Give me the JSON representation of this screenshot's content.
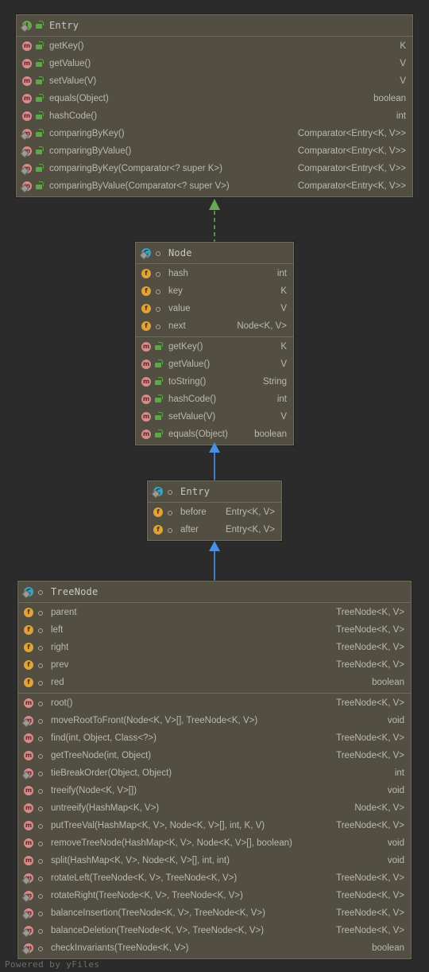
{
  "diagram": {
    "watermark": "Powered by yFiles",
    "colors": {
      "background": "#2b2b2b",
      "box_fill": "#524e42",
      "box_border": "#6e6a5c",
      "text": "#b9b9b4",
      "title_text": "#c8c8c4",
      "interface_icon": "#6aa84f",
      "class_icon": "#3ba3c4",
      "field_icon": "#e0a33b",
      "method_icon": "#d98a8a",
      "realization_edge": "#6aa84f",
      "generalization_edge": "#4a90e2"
    }
  },
  "boxes": [
    {
      "id": "entry-interface",
      "name": "Entry",
      "stereotype_icon": "interface-icon",
      "visibility": "public",
      "sections": [
        {
          "members": [
            {
              "icon": "method-icon",
              "static": false,
              "visibility": "public",
              "name": "getKey()",
              "type": "K"
            },
            {
              "icon": "method-icon",
              "static": false,
              "visibility": "public",
              "name": "getValue()",
              "type": "V"
            },
            {
              "icon": "method-icon",
              "static": false,
              "visibility": "public",
              "name": "setValue(V)",
              "type": "V"
            },
            {
              "icon": "method-icon",
              "static": false,
              "visibility": "public",
              "name": "equals(Object)",
              "type": "boolean"
            },
            {
              "icon": "method-icon",
              "static": false,
              "visibility": "public",
              "name": "hashCode()",
              "type": "int"
            },
            {
              "icon": "method-icon",
              "static": true,
              "visibility": "public",
              "name": "comparingByKey()",
              "type": "Comparator<Entry<K, V>>"
            },
            {
              "icon": "method-icon",
              "static": true,
              "visibility": "public",
              "name": "comparingByValue()",
              "type": "Comparator<Entry<K, V>>"
            },
            {
              "icon": "method-icon",
              "static": true,
              "visibility": "public",
              "name": "comparingByKey(Comparator<? super K>)",
              "type": "Comparator<Entry<K, V>>"
            },
            {
              "icon": "method-icon",
              "static": true,
              "visibility": "public",
              "name": "comparingByValue(Comparator<? super V>)",
              "type": "Comparator<Entry<K, V>>"
            }
          ]
        }
      ]
    },
    {
      "id": "node-class",
      "name": "Node",
      "stereotype_icon": "class-icon",
      "visibility": "package",
      "sections": [
        {
          "members": [
            {
              "icon": "field-icon",
              "static": false,
              "visibility": "package",
              "name": "hash",
              "type": "int"
            },
            {
              "icon": "field-icon",
              "static": false,
              "visibility": "package",
              "name": "key",
              "type": "K"
            },
            {
              "icon": "field-icon",
              "static": false,
              "visibility": "package",
              "name": "value",
              "type": "V"
            },
            {
              "icon": "field-icon",
              "static": false,
              "visibility": "package",
              "name": "next",
              "type": "Node<K, V>"
            }
          ]
        },
        {
          "members": [
            {
              "icon": "method-icon",
              "static": false,
              "visibility": "public",
              "name": "getKey()",
              "type": "K"
            },
            {
              "icon": "method-icon",
              "static": false,
              "visibility": "public",
              "name": "getValue()",
              "type": "V"
            },
            {
              "icon": "method-icon",
              "static": false,
              "visibility": "public",
              "name": "toString()",
              "type": "String"
            },
            {
              "icon": "method-icon",
              "static": false,
              "visibility": "public",
              "name": "hashCode()",
              "type": "int"
            },
            {
              "icon": "method-icon",
              "static": false,
              "visibility": "public",
              "name": "setValue(V)",
              "type": "V"
            },
            {
              "icon": "method-icon",
              "static": false,
              "visibility": "public",
              "name": "equals(Object)",
              "type": "boolean"
            }
          ]
        }
      ]
    },
    {
      "id": "entry-class",
      "name": "Entry",
      "stereotype_icon": "class-icon",
      "visibility": "package",
      "sections": [
        {
          "members": [
            {
              "icon": "field-icon",
              "static": false,
              "visibility": "package",
              "name": "before",
              "type": "Entry<K, V>"
            },
            {
              "icon": "field-icon",
              "static": false,
              "visibility": "package",
              "name": "after",
              "type": "Entry<K, V>"
            }
          ]
        }
      ]
    },
    {
      "id": "treenode-class",
      "name": "TreeNode",
      "stereotype_icon": "class-icon",
      "visibility": "package",
      "sections": [
        {
          "members": [
            {
              "icon": "field-icon",
              "static": false,
              "visibility": "package",
              "name": "parent",
              "type": "TreeNode<K, V>"
            },
            {
              "icon": "field-icon",
              "static": false,
              "visibility": "package",
              "name": "left",
              "type": "TreeNode<K, V>"
            },
            {
              "icon": "field-icon",
              "static": false,
              "visibility": "package",
              "name": "right",
              "type": "TreeNode<K, V>"
            },
            {
              "icon": "field-icon",
              "static": false,
              "visibility": "package",
              "name": "prev",
              "type": "TreeNode<K, V>"
            },
            {
              "icon": "field-icon",
              "static": false,
              "visibility": "package",
              "name": "red",
              "type": "boolean"
            }
          ]
        },
        {
          "members": [
            {
              "icon": "method-icon",
              "static": false,
              "visibility": "package",
              "name": "root()",
              "type": "TreeNode<K, V>"
            },
            {
              "icon": "method-icon",
              "static": true,
              "visibility": "package",
              "name": "moveRootToFront(Node<K, V>[], TreeNode<K, V>)",
              "type": "void"
            },
            {
              "icon": "method-icon",
              "static": false,
              "visibility": "package",
              "name": "find(int, Object, Class<?>)",
              "type": "TreeNode<K, V>"
            },
            {
              "icon": "method-icon",
              "static": false,
              "visibility": "package",
              "name": "getTreeNode(int, Object)",
              "type": "TreeNode<K, V>"
            },
            {
              "icon": "method-icon",
              "static": true,
              "visibility": "package",
              "name": "tieBreakOrder(Object, Object)",
              "type": "int"
            },
            {
              "icon": "method-icon",
              "static": false,
              "visibility": "package",
              "name": "treeify(Node<K, V>[])",
              "type": "void"
            },
            {
              "icon": "method-icon",
              "static": false,
              "visibility": "package",
              "name": "untreeify(HashMap<K, V>)",
              "type": "Node<K, V>"
            },
            {
              "icon": "method-icon",
              "static": false,
              "visibility": "package",
              "name": "putTreeVal(HashMap<K, V>, Node<K, V>[], int, K, V)",
              "type": "TreeNode<K, V>"
            },
            {
              "icon": "method-icon",
              "static": false,
              "visibility": "package",
              "name": "removeTreeNode(HashMap<K, V>, Node<K, V>[], boolean)",
              "type": "void"
            },
            {
              "icon": "method-icon",
              "static": false,
              "visibility": "package",
              "name": "split(HashMap<K, V>, Node<K, V>[], int, int)",
              "type": "void"
            },
            {
              "icon": "method-icon",
              "static": true,
              "visibility": "package",
              "name": "rotateLeft(TreeNode<K, V>, TreeNode<K, V>)",
              "type": "TreeNode<K, V>"
            },
            {
              "icon": "method-icon",
              "static": true,
              "visibility": "package",
              "name": "rotateRight(TreeNode<K, V>, TreeNode<K, V>)",
              "type": "TreeNode<K, V>"
            },
            {
              "icon": "method-icon",
              "static": true,
              "visibility": "package",
              "name": "balanceInsertion(TreeNode<K, V>, TreeNode<K, V>)",
              "type": "TreeNode<K, V>"
            },
            {
              "icon": "method-icon",
              "static": true,
              "visibility": "package",
              "name": "balanceDeletion(TreeNode<K, V>, TreeNode<K, V>)",
              "type": "TreeNode<K, V>"
            },
            {
              "icon": "method-icon",
              "static": true,
              "visibility": "package",
              "name": "checkInvariants(TreeNode<K, V>)",
              "type": "boolean"
            }
          ]
        }
      ]
    }
  ],
  "edges": [
    {
      "id": "node-implements-entry",
      "from": "node-class",
      "to": "entry-interface",
      "kind": "realization",
      "style": "dashed",
      "color": "#6aa84f"
    },
    {
      "id": "entry-extends-node",
      "from": "entry-class",
      "to": "node-class",
      "kind": "generalization",
      "style": "solid",
      "color": "#4a90e2"
    },
    {
      "id": "treenode-extends-entry",
      "from": "treenode-class",
      "to": "entry-class",
      "kind": "generalization",
      "style": "solid",
      "color": "#4a90e2"
    }
  ]
}
